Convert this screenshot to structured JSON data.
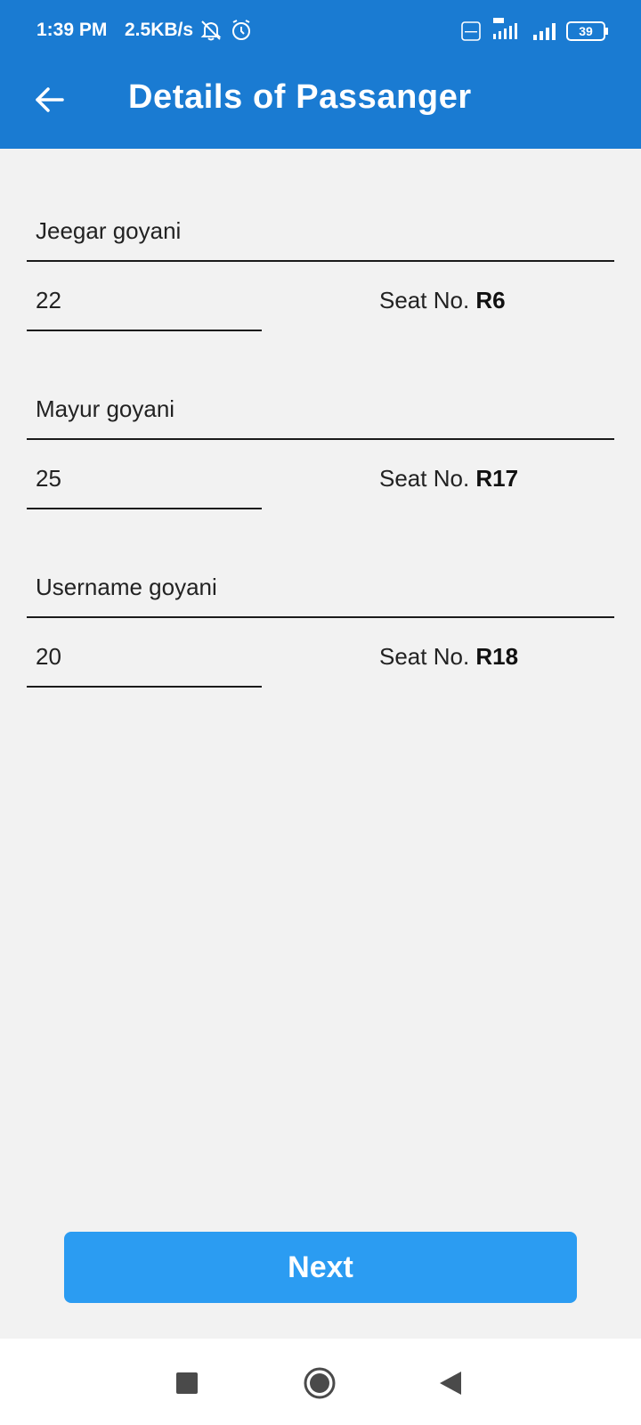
{
  "status_bar": {
    "time": "1:39 PM",
    "speed": "2.5KB/s",
    "battery": "39",
    "icons": [
      "bell-off-icon",
      "alarm-icon",
      "volte-icon",
      "signal-4g-icon",
      "signal-icon",
      "battery-icon"
    ]
  },
  "toolbar": {
    "title": "Details of Passanger",
    "back_icon": "arrow-left-icon",
    "color": "#1a7bd2"
  },
  "passengers": [
    {
      "name": "Jeegar goyani",
      "age": "22",
      "seat_label": "Seat No.",
      "seat": "R6"
    },
    {
      "name": "Mayur goyani",
      "age": "25",
      "seat_label": "Seat No.",
      "seat": "R17"
    },
    {
      "name": "Username goyani",
      "age": "20",
      "seat_label": "Seat No.",
      "seat": "R18"
    }
  ],
  "next_button": {
    "label": "Next",
    "color": "#2b9cf2"
  },
  "nav_bar": {
    "icons": [
      "recents-icon",
      "home-icon",
      "back-icon"
    ]
  }
}
